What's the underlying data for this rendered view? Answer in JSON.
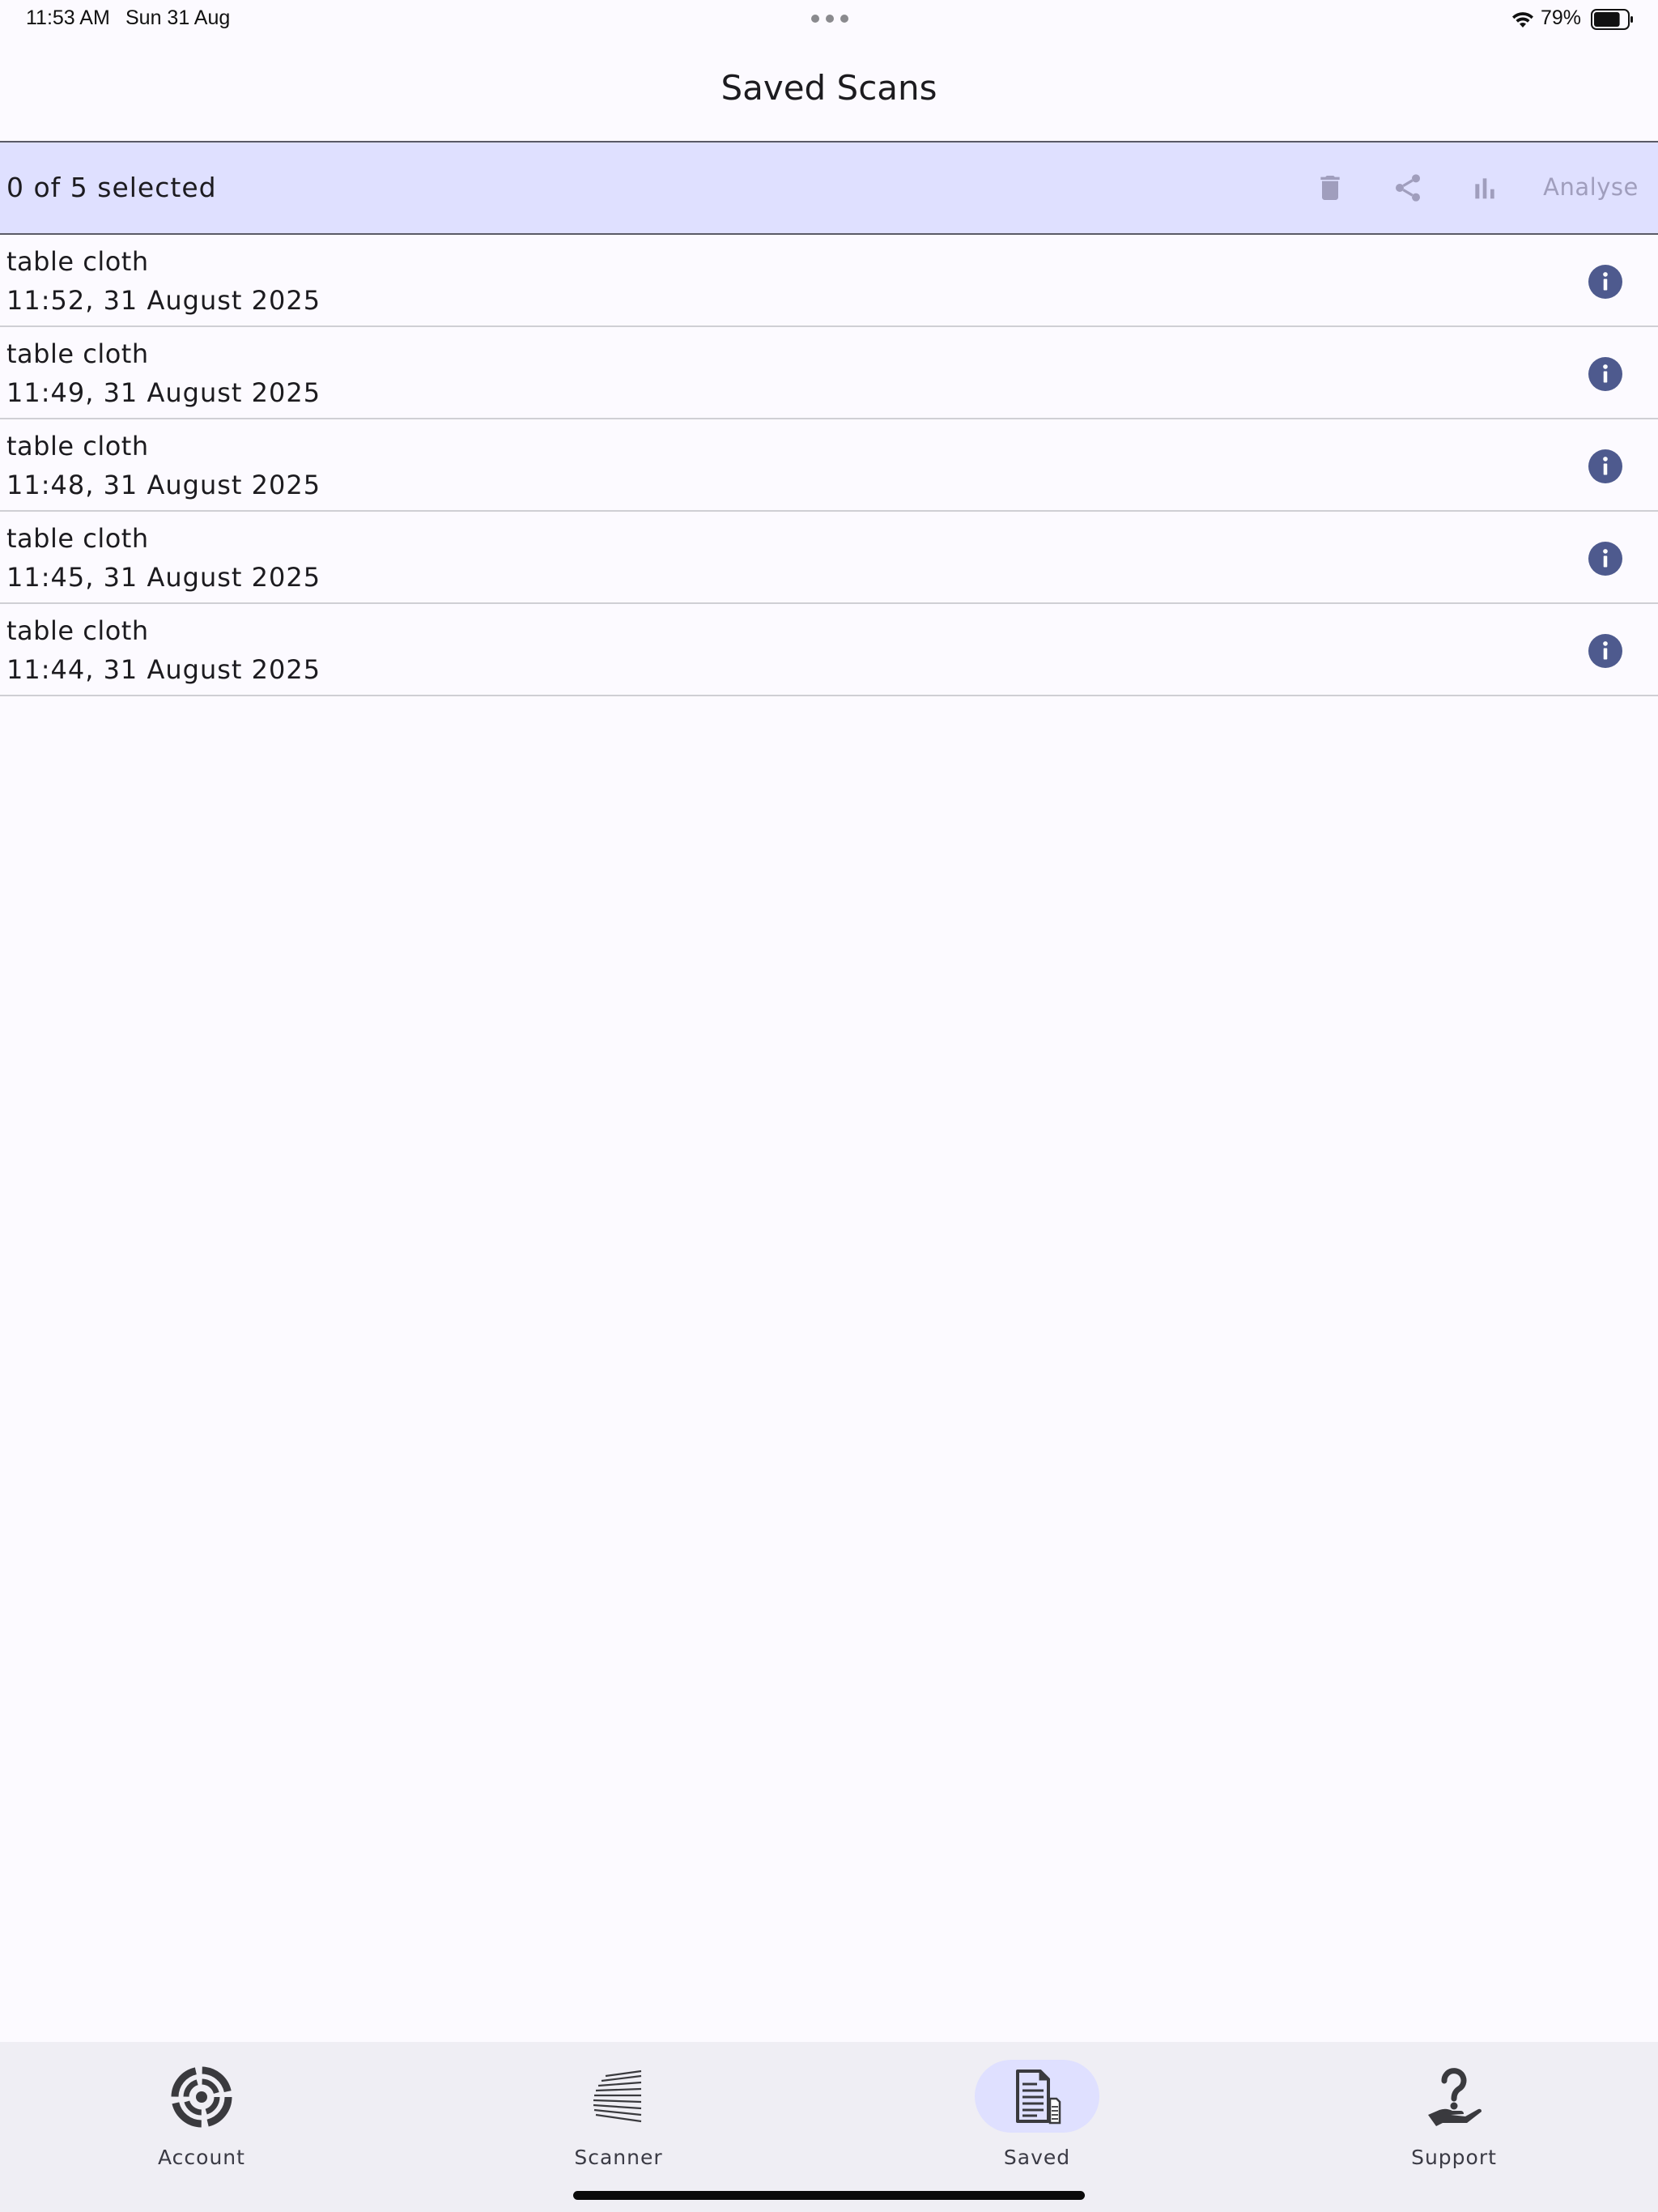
{
  "status_bar": {
    "time": "11:53 AM",
    "date": "Sun 31 Aug",
    "battery_percent": "79%",
    "battery_level": 0.79
  },
  "header": {
    "title": "Saved Scans"
  },
  "selection_toolbar": {
    "count_text": "0 of 5 selected",
    "actions": {
      "delete_icon": "trash-icon",
      "share_icon": "share-icon",
      "chart_icon": "bar-chart-icon",
      "analyse_label": "Analyse"
    }
  },
  "scans": [
    {
      "name": "table cloth",
      "timestamp": "11:52, 31 August 2025"
    },
    {
      "name": "table cloth",
      "timestamp": "11:49, 31 August 2025"
    },
    {
      "name": "table cloth",
      "timestamp": "11:48, 31 August 2025"
    },
    {
      "name": "table cloth",
      "timestamp": "11:45, 31 August 2025"
    },
    {
      "name": "table cloth",
      "timestamp": "11:44, 31 August 2025"
    }
  ],
  "bottom_nav": {
    "items": [
      {
        "label": "Account",
        "icon": "target-icon",
        "active": false
      },
      {
        "label": "Scanner",
        "icon": "scanner-icon",
        "active": false
      },
      {
        "label": "Saved",
        "icon": "document-icon",
        "active": true
      },
      {
        "label": "Support",
        "icon": "help-hand-icon",
        "active": false
      }
    ]
  },
  "colors": {
    "background": "#fcfaff",
    "selection_bar": "#dfe0ff",
    "info_icon": "#4e5a8e",
    "disabled_action": "#a09ebd",
    "nav_background": "#efeef4"
  }
}
